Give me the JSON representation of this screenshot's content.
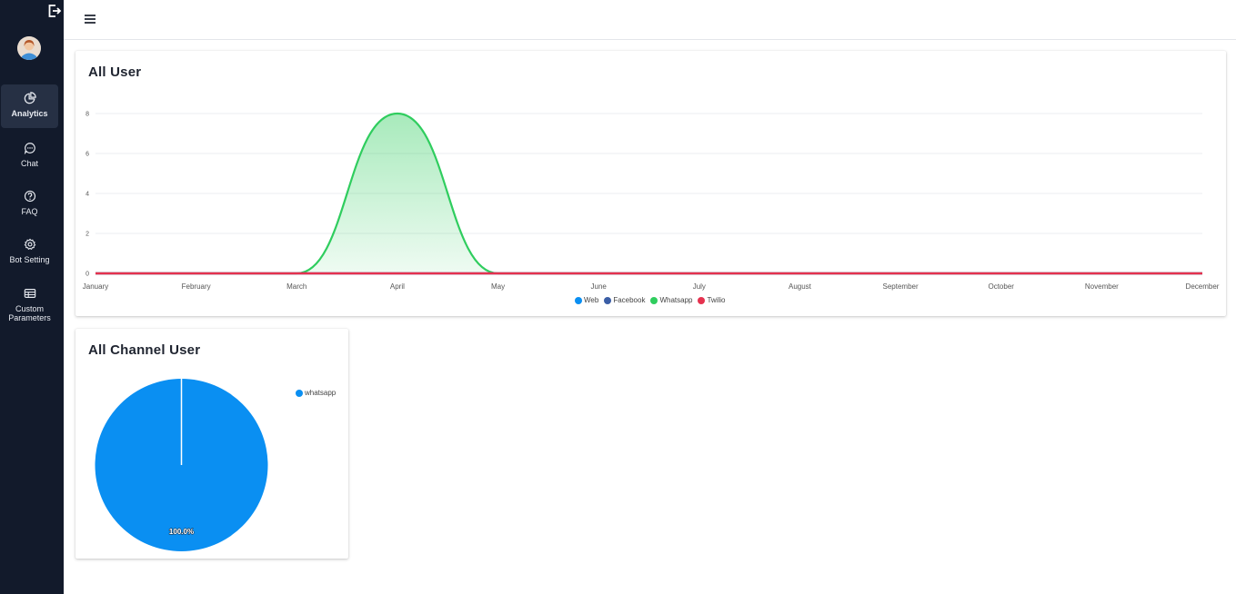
{
  "nav": {
    "items": [
      {
        "label": "Analytics",
        "icon": "pie-chart-icon",
        "active": true
      },
      {
        "label": "Chat",
        "icon": "chat-bubble-icon",
        "active": false
      },
      {
        "label": "FAQ",
        "icon": "question-circle-icon",
        "active": false
      },
      {
        "label": "Bot Setting",
        "icon": "gear-icon",
        "active": false
      },
      {
        "label": "Custom Parameters",
        "icon": "table-icon",
        "active": false
      }
    ]
  },
  "colors": {
    "sidebar_bg": "#121a2b",
    "web": "#0a8ff2",
    "facebook": "#3b5ea6",
    "whatsapp": "#2fcd5e",
    "twilio": "#e5324f"
  },
  "cards": {
    "all_user": {
      "title": "All User"
    },
    "all_channel_user": {
      "title": "All Channel User"
    }
  },
  "chart_data": [
    {
      "type": "line",
      "title": "All User",
      "x": [
        "January",
        "February",
        "March",
        "April",
        "May",
        "June",
        "July",
        "August",
        "September",
        "October",
        "November",
        "December"
      ],
      "ylim": [
        0,
        8
      ],
      "yticks": [
        0,
        2,
        4,
        6,
        8
      ],
      "grid": true,
      "legend_position": "bottom",
      "series": [
        {
          "name": "Web",
          "color": "#0a8ff2",
          "values": [
            0,
            0,
            0,
            0,
            0,
            0,
            0,
            0,
            0,
            0,
            0,
            0
          ]
        },
        {
          "name": "Facebook",
          "color": "#3b5ea6",
          "values": [
            0,
            0,
            0,
            0,
            0,
            0,
            0,
            0,
            0,
            0,
            0,
            0
          ]
        },
        {
          "name": "Whatsapp",
          "color": "#2fcd5e",
          "values": [
            0,
            0,
            0,
            8,
            0,
            0,
            0,
            0,
            0,
            0,
            0,
            0
          ],
          "fill": true
        },
        {
          "name": "Twilio",
          "color": "#e5324f",
          "values": [
            0,
            0,
            0,
            0,
            0,
            0,
            0,
            0,
            0,
            0,
            0,
            0
          ]
        }
      ]
    },
    {
      "type": "pie",
      "title": "All Channel User",
      "legend_position": "top-right",
      "slices": [
        {
          "label": "whatsapp",
          "value": 100.0,
          "display": "100.0%",
          "color": "#0a8ff2"
        }
      ]
    }
  ]
}
